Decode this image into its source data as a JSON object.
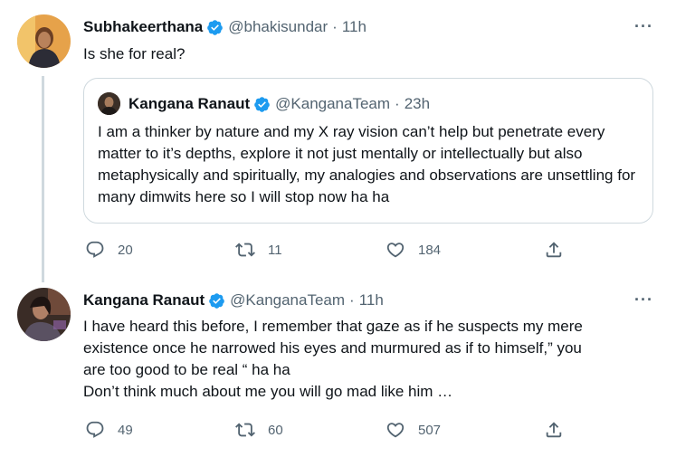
{
  "tweets": [
    {
      "name": "Subhakeerthana",
      "handle": "@bhakisundar",
      "separator": "·",
      "time": "11h",
      "text": "Is she for real?",
      "more": "···",
      "quote": {
        "name": "Kangana Ranaut",
        "handle": "@KanganaTeam",
        "separator": "·",
        "time": "23h",
        "text": "I am a thinker by nature and my X ray vision can’t help but penetrate every matter to it’s depths, explore it not just mentally or intellectually but also metaphysically and spiritually, my analogies and observations are unsettling for many dimwits here so I will stop now ha ha"
      },
      "actions": {
        "replies": "20",
        "retweets": "11",
        "likes": "184"
      }
    },
    {
      "name": "Kangana Ranaut",
      "handle": "@KanganaTeam",
      "separator": "·",
      "time": "11h",
      "text_lines": [
        "I have heard this before, I remember that gaze as if he suspects my mere",
        "existence once he narrowed his eyes and murmured as if to himself,” you",
        "are too good to be real “ ha ha",
        "Don’t think much about me you will go mad like him …"
      ],
      "more": "···",
      "actions": {
        "replies": "49",
        "retweets": "60",
        "likes": "507"
      }
    }
  ],
  "colors": {
    "verified": "#1d9bf0",
    "secondary_text": "#536471",
    "border": "#cfd9de"
  },
  "icons": [
    "verified-badge-icon",
    "reply-icon",
    "retweet-icon",
    "like-icon",
    "share-icon",
    "more-icon"
  ]
}
